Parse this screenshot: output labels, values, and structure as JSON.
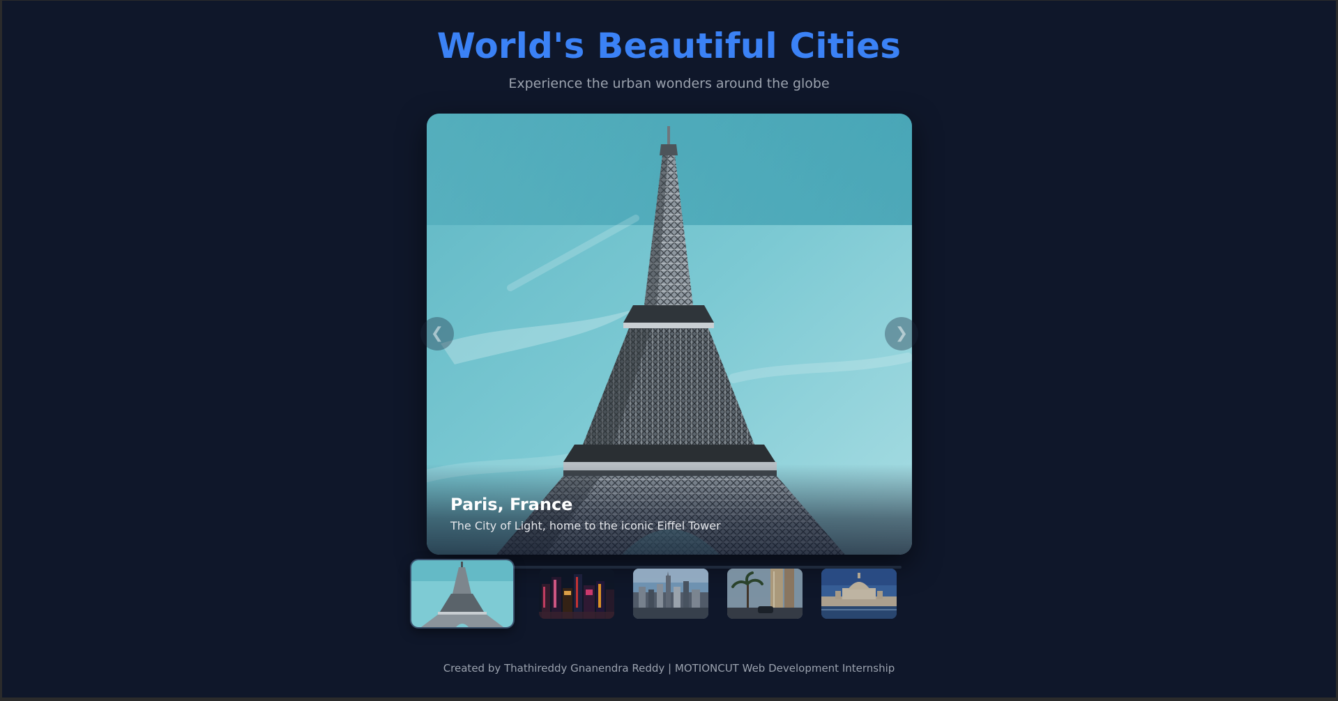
{
  "header": {
    "title": "World's Beautiful Cities",
    "subtitle": "Experience the urban wonders around the globe"
  },
  "slider": {
    "active_index": 0,
    "progress": 0.03,
    "current": {
      "title": "Paris, France",
      "description": "The City of Light, home to the iconic Eiffel Tower"
    },
    "prev_icon": "chevron-left-icon",
    "next_icon": "chevron-right-icon",
    "thumbnails": [
      {
        "icon": "eiffel-tower-thumbnail",
        "active": true
      },
      {
        "icon": "night-city-thumbnail",
        "active": false
      },
      {
        "icon": "skyline-thumbnail",
        "active": false
      },
      {
        "icon": "palm-street-thumbnail",
        "active": false
      },
      {
        "icon": "domed-cathedral-thumbnail",
        "active": false
      }
    ]
  },
  "footer": {
    "credit": "Created by Thathireddy Gnanendra Reddy | MOTIONCUT Web Development Internship"
  },
  "colors": {
    "background": "#0f172a",
    "accent": "#3b82f6",
    "muted_text": "#9ca3af"
  }
}
